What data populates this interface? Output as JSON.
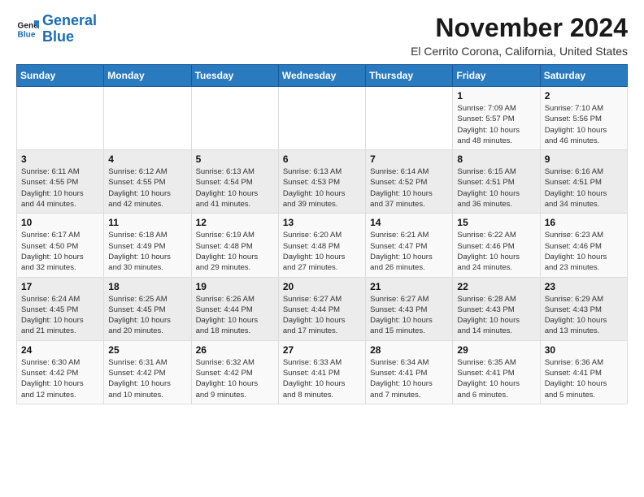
{
  "logo": {
    "line1": "General",
    "line2": "Blue"
  },
  "header": {
    "month": "November 2024",
    "location": "El Cerrito Corona, California, United States"
  },
  "weekdays": [
    "Sunday",
    "Monday",
    "Tuesday",
    "Wednesday",
    "Thursday",
    "Friday",
    "Saturday"
  ],
  "weeks": [
    [
      {
        "day": "",
        "info": ""
      },
      {
        "day": "",
        "info": ""
      },
      {
        "day": "",
        "info": ""
      },
      {
        "day": "",
        "info": ""
      },
      {
        "day": "",
        "info": ""
      },
      {
        "day": "1",
        "info": "Sunrise: 7:09 AM\nSunset: 5:57 PM\nDaylight: 10 hours\nand 48 minutes."
      },
      {
        "day": "2",
        "info": "Sunrise: 7:10 AM\nSunset: 5:56 PM\nDaylight: 10 hours\nand 46 minutes."
      }
    ],
    [
      {
        "day": "3",
        "info": "Sunrise: 6:11 AM\nSunset: 4:55 PM\nDaylight: 10 hours\nand 44 minutes."
      },
      {
        "day": "4",
        "info": "Sunrise: 6:12 AM\nSunset: 4:55 PM\nDaylight: 10 hours\nand 42 minutes."
      },
      {
        "day": "5",
        "info": "Sunrise: 6:13 AM\nSunset: 4:54 PM\nDaylight: 10 hours\nand 41 minutes."
      },
      {
        "day": "6",
        "info": "Sunrise: 6:13 AM\nSunset: 4:53 PM\nDaylight: 10 hours\nand 39 minutes."
      },
      {
        "day": "7",
        "info": "Sunrise: 6:14 AM\nSunset: 4:52 PM\nDaylight: 10 hours\nand 37 minutes."
      },
      {
        "day": "8",
        "info": "Sunrise: 6:15 AM\nSunset: 4:51 PM\nDaylight: 10 hours\nand 36 minutes."
      },
      {
        "day": "9",
        "info": "Sunrise: 6:16 AM\nSunset: 4:51 PM\nDaylight: 10 hours\nand 34 minutes."
      }
    ],
    [
      {
        "day": "10",
        "info": "Sunrise: 6:17 AM\nSunset: 4:50 PM\nDaylight: 10 hours\nand 32 minutes."
      },
      {
        "day": "11",
        "info": "Sunrise: 6:18 AM\nSunset: 4:49 PM\nDaylight: 10 hours\nand 30 minutes."
      },
      {
        "day": "12",
        "info": "Sunrise: 6:19 AM\nSunset: 4:48 PM\nDaylight: 10 hours\nand 29 minutes."
      },
      {
        "day": "13",
        "info": "Sunrise: 6:20 AM\nSunset: 4:48 PM\nDaylight: 10 hours\nand 27 minutes."
      },
      {
        "day": "14",
        "info": "Sunrise: 6:21 AM\nSunset: 4:47 PM\nDaylight: 10 hours\nand 26 minutes."
      },
      {
        "day": "15",
        "info": "Sunrise: 6:22 AM\nSunset: 4:46 PM\nDaylight: 10 hours\nand 24 minutes."
      },
      {
        "day": "16",
        "info": "Sunrise: 6:23 AM\nSunset: 4:46 PM\nDaylight: 10 hours\nand 23 minutes."
      }
    ],
    [
      {
        "day": "17",
        "info": "Sunrise: 6:24 AM\nSunset: 4:45 PM\nDaylight: 10 hours\nand 21 minutes."
      },
      {
        "day": "18",
        "info": "Sunrise: 6:25 AM\nSunset: 4:45 PM\nDaylight: 10 hours\nand 20 minutes."
      },
      {
        "day": "19",
        "info": "Sunrise: 6:26 AM\nSunset: 4:44 PM\nDaylight: 10 hours\nand 18 minutes."
      },
      {
        "day": "20",
        "info": "Sunrise: 6:27 AM\nSunset: 4:44 PM\nDaylight: 10 hours\nand 17 minutes."
      },
      {
        "day": "21",
        "info": "Sunrise: 6:27 AM\nSunset: 4:43 PM\nDaylight: 10 hours\nand 15 minutes."
      },
      {
        "day": "22",
        "info": "Sunrise: 6:28 AM\nSunset: 4:43 PM\nDaylight: 10 hours\nand 14 minutes."
      },
      {
        "day": "23",
        "info": "Sunrise: 6:29 AM\nSunset: 4:43 PM\nDaylight: 10 hours\nand 13 minutes."
      }
    ],
    [
      {
        "day": "24",
        "info": "Sunrise: 6:30 AM\nSunset: 4:42 PM\nDaylight: 10 hours\nand 12 minutes."
      },
      {
        "day": "25",
        "info": "Sunrise: 6:31 AM\nSunset: 4:42 PM\nDaylight: 10 hours\nand 10 minutes."
      },
      {
        "day": "26",
        "info": "Sunrise: 6:32 AM\nSunset: 4:42 PM\nDaylight: 10 hours\nand 9 minutes."
      },
      {
        "day": "27",
        "info": "Sunrise: 6:33 AM\nSunset: 4:41 PM\nDaylight: 10 hours\nand 8 minutes."
      },
      {
        "day": "28",
        "info": "Sunrise: 6:34 AM\nSunset: 4:41 PM\nDaylight: 10 hours\nand 7 minutes."
      },
      {
        "day": "29",
        "info": "Sunrise: 6:35 AM\nSunset: 4:41 PM\nDaylight: 10 hours\nand 6 minutes."
      },
      {
        "day": "30",
        "info": "Sunrise: 6:36 AM\nSunset: 4:41 PM\nDaylight: 10 hours\nand 5 minutes."
      }
    ]
  ]
}
